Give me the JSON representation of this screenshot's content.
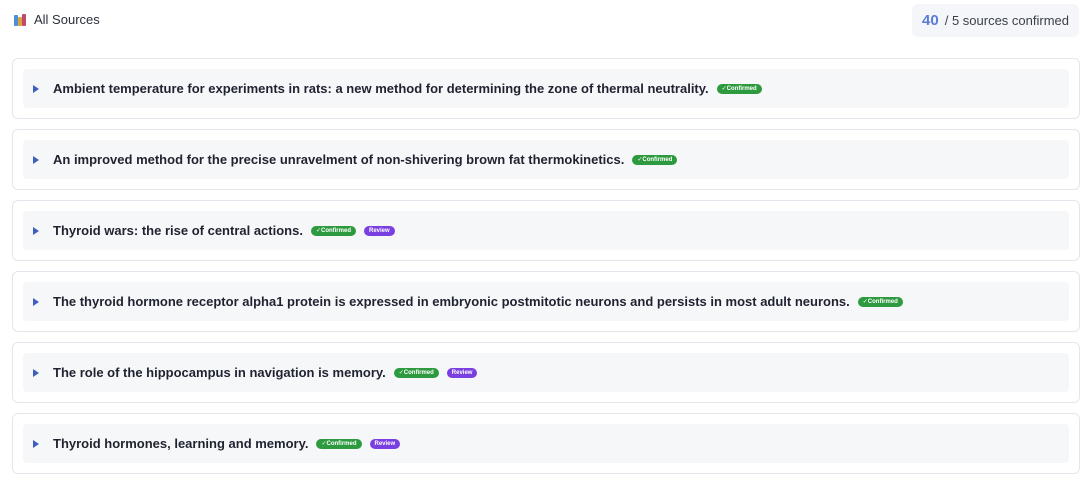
{
  "header": {
    "title": "All Sources",
    "counter_value": "40",
    "counter_label": "/ 5 sources confirmed"
  },
  "sources": [
    {
      "title": "Ambient temperature for experiments in rats: a new method for determining the zone of thermal neutrality.",
      "badges": [
        "✓Confirmed"
      ]
    },
    {
      "title": "An improved method for the precise unravelment of non-shivering brown fat thermokinetics.",
      "badges": [
        "✓Confirmed"
      ]
    },
    {
      "title": "Thyroid wars: the rise of central actions.",
      "badges": [
        "✓Confirmed",
        "Review"
      ]
    },
    {
      "title": "The thyroid hormone receptor alpha1 protein is expressed in embryonic postmitotic neurons and persists in most adult neurons.",
      "badges": [
        "✓Confirmed"
      ]
    },
    {
      "title": "The role of the hippocampus in navigation is memory.",
      "badges": [
        "✓Confirmed",
        "Review"
      ]
    },
    {
      "title": "Thyroid hormones, learning and memory.",
      "badges": [
        "✓Confirmed",
        "Review"
      ]
    }
  ],
  "colors": {
    "accent": "#5b7bd6",
    "confirmed": "#2e9a3f",
    "review": "#7a3fe0"
  }
}
